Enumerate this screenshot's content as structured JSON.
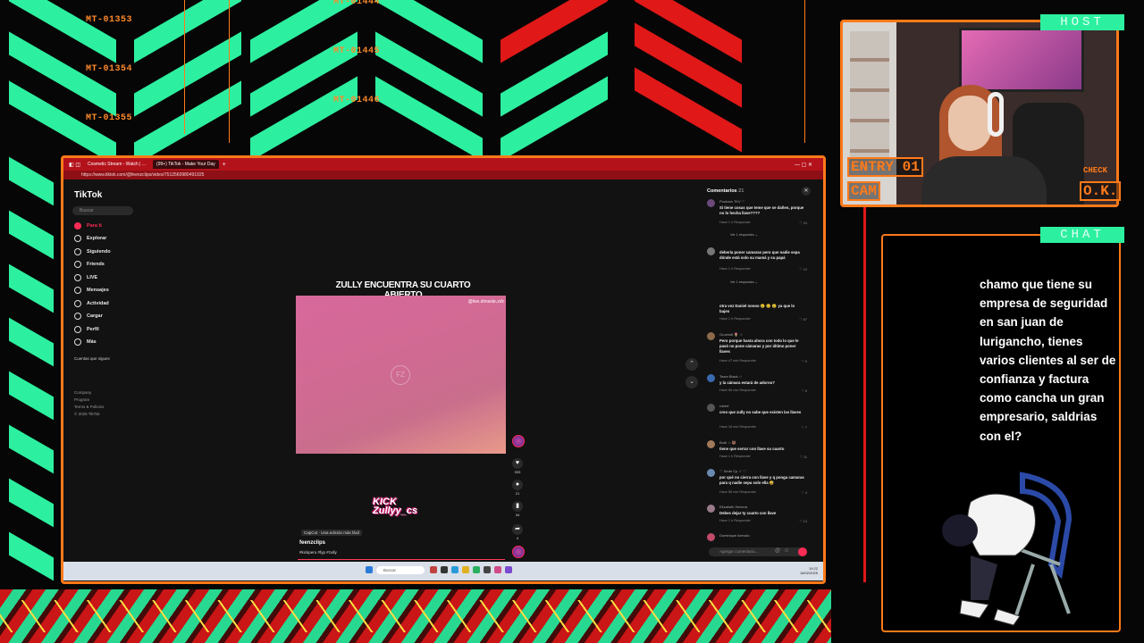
{
  "overlay": {
    "tags": [
      "MT-01353",
      "MT-01354",
      "MT-01355",
      "MT-01444",
      "MT-01445",
      "MT-01446"
    ],
    "host_label": "HOST",
    "chat_label": "CHAT",
    "cam_labels": {
      "entry": "ENTRY 01",
      "cam": "CAM",
      "check": "CHECK",
      "ok": "O.K."
    }
  },
  "chat": {
    "message": "chamo que tiene su empresa de seguridad en san juan de lurigancho, tienes varios clientes al ser de confianza y factura como cancha un gran empresario, saldrias con el?"
  },
  "browser": {
    "tabs": [
      "Cosmetic Stream - Watch | ...",
      "(99+) TikTok - Make Your Day"
    ],
    "url": "https://www.tiktok.com/@feenzclips/video/7512560980491925"
  },
  "tiktok": {
    "logo": "TikTok",
    "search_placeholder": "Buscar",
    "nav": [
      {
        "label": "Para ti",
        "icon": "home-icon"
      },
      {
        "label": "Explorar",
        "icon": "compass-icon"
      },
      {
        "label": "Siguiendo",
        "icon": "following-icon"
      },
      {
        "label": "Friends",
        "icon": "friends-icon"
      },
      {
        "label": "LIVE",
        "icon": "live-icon"
      },
      {
        "label": "Mensajes",
        "icon": "message-icon"
      },
      {
        "label": "Actividad",
        "icon": "activity-icon"
      },
      {
        "label": "Cargar",
        "icon": "upload-icon"
      },
      {
        "label": "Perfil",
        "icon": "profile-icon"
      },
      {
        "label": "Más",
        "icon": "more-icon"
      }
    ],
    "following_title": "Cuentas que sigues",
    "footer": [
      "Company",
      "Program",
      "Terms & Policies",
      "© 2025 TikTok"
    ]
  },
  "video": {
    "title": "ZULLY ENCUENTRA SU CUARTO ABIERTO",
    "watermark": "@live.dsnasle.zdv",
    "fz": "FZ",
    "kick_logo": "KICK",
    "kick_user": "Zullyy_cs",
    "capcut": "CapCut · Una edición más fácil",
    "username": "feenzclips",
    "hashtags": "#kickperu #fyp #zully",
    "actions": [
      {
        "icon": "heart-icon",
        "count": "933"
      },
      {
        "icon": "comment-icon",
        "count": "21"
      },
      {
        "icon": "bookmark-icon",
        "count": "34"
      },
      {
        "icon": "share-icon",
        "count": "4"
      }
    ]
  },
  "comments": {
    "header": "Comentarios",
    "count": "21",
    "items": [
      {
        "user": "Poubam TKV ♡",
        "text": "Si tiene cosas que teme que se dañen, porque no lo hecha llave????",
        "meta": "Hace 1 h   Responder",
        "likes": "♡ 24",
        "replies": "Ver 1 respuesta ⌄"
      },
      {
        "user": "",
        "text": "debería poner camaras pero que nadie sepa dónde está solo su mamá y su papá",
        "meta": "Hace 1 h   Responder",
        "likes": "♡ 10",
        "replies": "Ver 1 respuesta ⌄"
      },
      {
        "user": "",
        "text": "otra vez Daniel noooo 😢 😢 😢 ya que lo bajen",
        "meta": "Hace 1 h   Responder",
        "likes": "♡ 67",
        "replies": ""
      },
      {
        "user": "Oruchoff 🌷 ☆",
        "text": "Pero porque hasta ahora con todo lo que le pasó no pone cámaras y por último poner llaves",
        "meta": "Hace 47 min   Responder",
        "likes": "♡ 9",
        "replies": ""
      },
      {
        "user": "Team Black ☆",
        "text": "y la cámara estará de adorno?",
        "meta": "Hace 56 min   Responder",
        "likes": "♡ 6",
        "replies": ""
      },
      {
        "user": "robert",
        "text": "creo que zully no sabe que existen las llaves",
        "meta": "Hace 16 min   Responder",
        "likes": "♡ 7",
        "replies": ""
      },
      {
        "user": "Budi ☆ 🐻",
        "text": "tiene que serrar con llave su cuarto",
        "meta": "Hace 1 h   Responder",
        "likes": "♡ 11",
        "replies": ""
      },
      {
        "user": "♡ Sede Cp ☆ ♡",
        "text": "por qué no cierra con llave y q ponga camaras para q nadie sepa solo ella 😅",
        "meta": "Hace 56 min   Responder",
        "likes": "♡ 4",
        "replies": ""
      },
      {
        "user": "Elizabeth Herrera",
        "text": "Debes dejar ty cuarto con llave",
        "meta": "Hace 1 h   Responder",
        "likes": "♡ 14",
        "replies": ""
      },
      {
        "user": "Dominique Arevalo",
        "text": "",
        "meta": "",
        "likes": "",
        "replies": ""
      }
    ],
    "input_placeholder": "Agregar comentario..."
  },
  "taskbar": {
    "search": "Buscar",
    "time": "19:22",
    "date": "16/02/2025"
  },
  "colors": {
    "accent_orange": "#ff7a1a",
    "neon_green": "#2cf0a0",
    "neon_red": "#e01818",
    "tiktok_pink": "#fe2c55",
    "browser_red": "#b3121b"
  }
}
